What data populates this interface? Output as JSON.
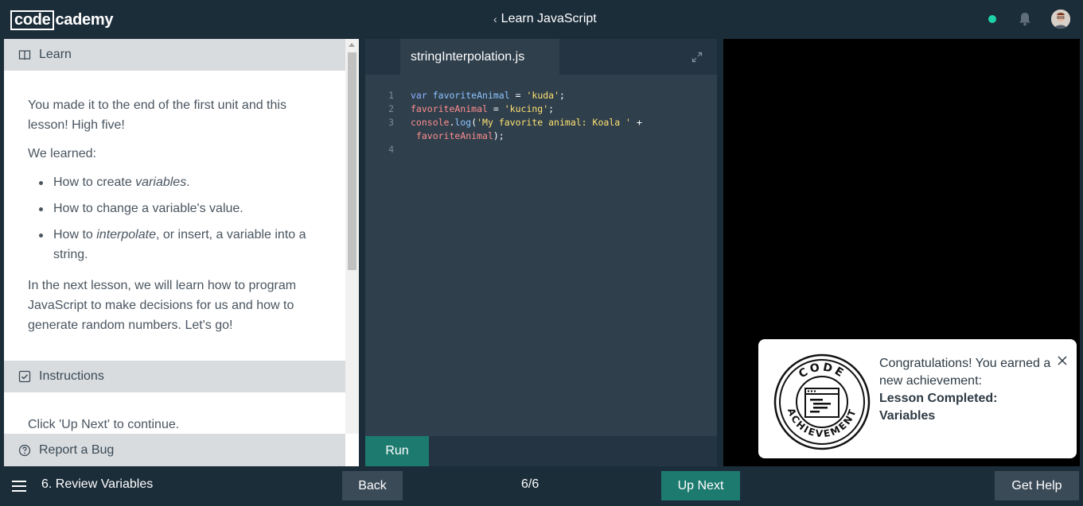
{
  "header": {
    "logo_code": "code",
    "logo_rest": "cademy",
    "course_title": "Learn JavaScript",
    "status_color": "#1dd3a7"
  },
  "lesson": {
    "learn_label": "Learn",
    "intro_1": "You made it to the end of the first unit and this lesson! High five!",
    "we_learned": "We learned:",
    "bullets": [
      {
        "before": "How to create ",
        "em": "variables",
        "after": "."
      },
      {
        "before": "How to change a variable's value.",
        "em": "",
        "after": ""
      },
      {
        "before": "How to ",
        "em": "interpolate",
        "after": ", or insert, a variable into a string."
      }
    ],
    "outro": "In the next lesson, we will learn how to program JavaScript to make decisions for us and how to generate random numbers. Let's go!",
    "instructions_label": "Instructions",
    "instructions_text": "Click 'Up Next' to continue.",
    "report_label": "Report a Bug"
  },
  "editor": {
    "file_name": "stringInterpolation.js",
    "line_numbers": [
      "1",
      "2",
      "3",
      "",
      "4"
    ],
    "run_label": "Run"
  },
  "toast": {
    "badge_top": "CODE",
    "badge_bottom": "ACHIEVEMENT",
    "message": "Congratulations! You earned a new achievement:",
    "achievement": "Lesson Completed: Variables"
  },
  "footer": {
    "lesson_name": "6. Review Variables",
    "back_label": "Back",
    "progress": "6/6",
    "next_label": "Up Next",
    "help_label": "Get Help"
  },
  "icons": {
    "learn": "book-icon",
    "instructions": "checkbox-icon",
    "report": "question-circle-icon",
    "expand": "expand-icon",
    "close": "close-icon",
    "menu": "hamburger-menu-icon",
    "bell": "bell-icon"
  }
}
